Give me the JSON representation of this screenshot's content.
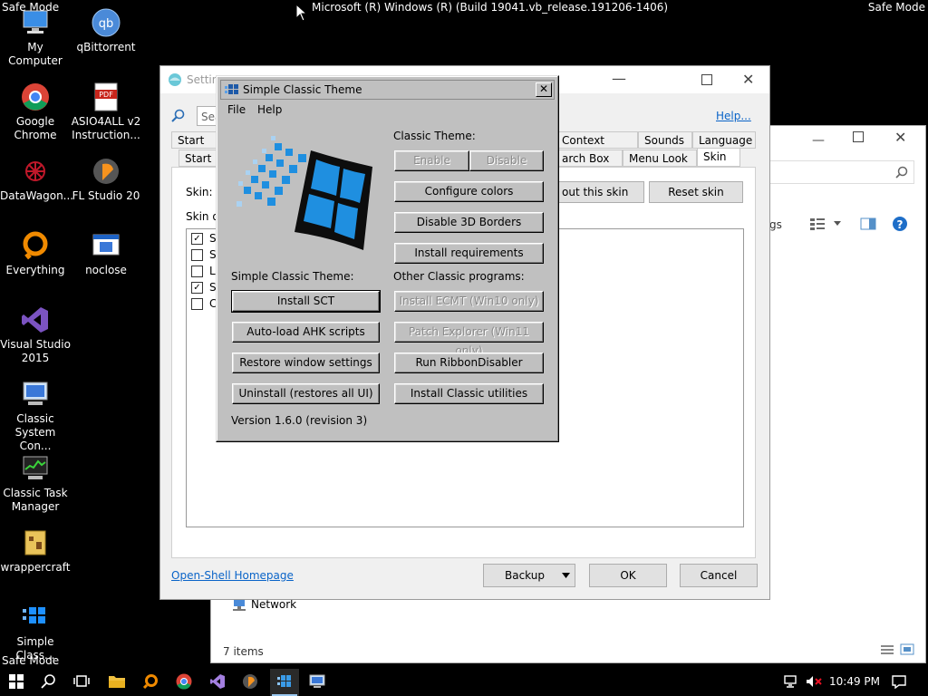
{
  "safe_mode_label": "Safe Mode",
  "os_build": "Microsoft (R) Windows (R) (Build 19041.vb_release.191206-1406)",
  "desktop_icons": [
    {
      "label": "My Computer",
      "icon": "computer-icon"
    },
    {
      "label": "qBittorrent",
      "icon": "qbittorrent-icon"
    },
    {
      "label": "Google Chrome",
      "icon": "chrome-icon"
    },
    {
      "label": "ASIO4ALL v2 Instruction...",
      "icon": "pdf-icon"
    },
    {
      "label": "DataWagon...",
      "icon": "datawagon-icon"
    },
    {
      "label": "FL Studio 20",
      "icon": "fl-studio-icon"
    },
    {
      "label": "Everything",
      "icon": "everything-icon"
    },
    {
      "label": "noclose",
      "icon": "noclose-icon"
    },
    {
      "label": "Visual Studio 2015",
      "icon": "visual-studio-icon"
    },
    {
      "label": "Classic System Con...",
      "icon": "control-panel-icon"
    },
    {
      "label": "Classic Task Manager",
      "icon": "task-manager-icon"
    },
    {
      "label": "wrappercraft",
      "icon": "wrappercraft-icon"
    },
    {
      "label": "Simple Class...",
      "icon": "simple-classic-icon"
    }
  ],
  "settings_window": {
    "title": "Settin",
    "search_placeholder": "Sea",
    "help_link": "Help...",
    "tabs_row1": [
      "Start Bu",
      "Context Menu",
      "Sounds",
      "Language"
    ],
    "tabs_row2": [
      "Start M",
      "arch Box",
      "Menu Look",
      "Skin"
    ],
    "skin_label": "Skin:",
    "about_skin_button": "out this skin",
    "reset_skin_button": "Reset skin",
    "skin_options_label": "Skin o",
    "options": [
      {
        "text": "S",
        "checked": true
      },
      {
        "text": "S",
        "checked": false
      },
      {
        "text": "L",
        "checked": false
      },
      {
        "text": "S",
        "checked": true
      },
      {
        "text": "C",
        "checked": false
      }
    ],
    "homepage_link": "Open-Shell Homepage",
    "backup_button": "Backup",
    "ok_button": "OK",
    "cancel_button": "Cancel"
  },
  "explorer_window": {
    "network_label": "Network",
    "status_items": "7 items",
    "options_label": "gs"
  },
  "sct_dialog": {
    "title": "Simple Classic Theme",
    "menu": [
      "File",
      "Help"
    ],
    "classic_theme_label": "Classic Theme:",
    "enable_button": "Enable",
    "disable_button": "Disable",
    "configure_colors_button": "Configure colors",
    "disable_3d_button": "Disable 3D Borders",
    "install_requirements_button": "Install requirements",
    "sct_label": "Simple Classic Theme:",
    "other_label": "Other Classic programs:",
    "install_sct_button": "Install SCT",
    "install_ecmt_button": "Install ECMT (Win10 only)",
    "autoload_button": "Auto-load AHK scripts",
    "patch_explorer_button": "Patch Explorer (Win11 only)",
    "restore_button": "Restore window settings",
    "ribbon_button": "Run RibbonDisabler",
    "uninstall_button": "Uninstall (restores all UI)",
    "install_utilities_button": "Install Classic utilities",
    "version": "Version 1.6.0 (revision 3)"
  },
  "taskbar": {
    "time": "10:49 PM"
  }
}
